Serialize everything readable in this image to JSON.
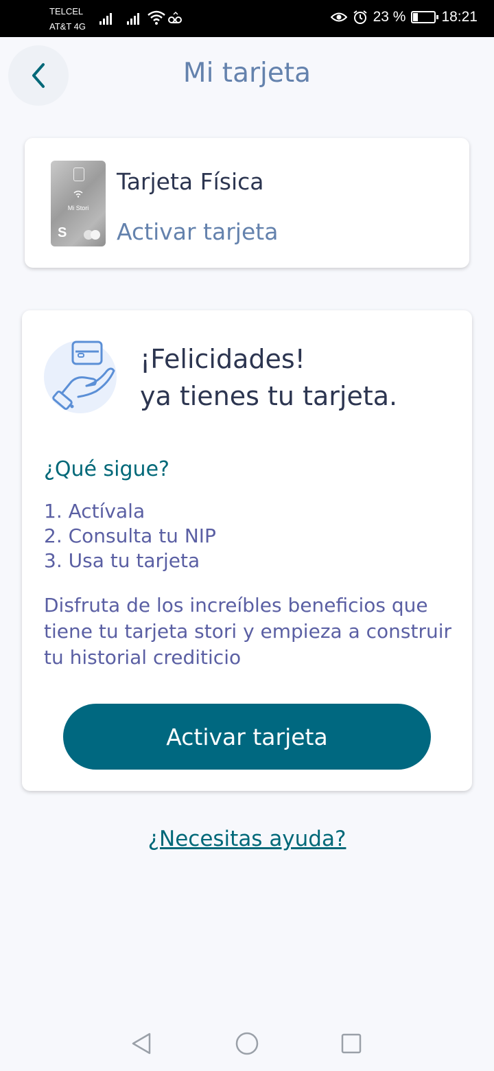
{
  "status_bar": {
    "carrier_1": "TELCEL",
    "carrier_2": "AT&T 4G",
    "battery_percent": "23 %",
    "battery_level": 0.23,
    "time": "18:21",
    "icons": [
      "signal-icon",
      "signal-icon",
      "wifi-icon",
      "voicemail-icon",
      "eye-icon",
      "alarm-icon",
      "battery-icon"
    ]
  },
  "header": {
    "title": "Mi tarjeta",
    "back_icon": "chevron-left-icon"
  },
  "card_summary": {
    "card_name": "Tarjeta Física",
    "card_brand_text": "Mi Stori",
    "action_label": "Activar tarjeta"
  },
  "main_card": {
    "headline_line1": "¡Felicidades!",
    "headline_line2": "ya tienes tu tarjeta.",
    "next_title": "¿Qué sigue?",
    "steps": [
      "1. Actívala",
      "2. Consulta tu NIP",
      "3. Usa tu tarjeta"
    ],
    "description": "Disfruta de los increíbles beneficios que tiene tu tarjeta stori y empieza a construir tu historial crediticio",
    "button_label": "Activar tarjeta"
  },
  "help_link": "¿Necesitas ayuda?",
  "colors": {
    "accent": "#006880",
    "title_blue": "#6482ad",
    "text_dark": "#2c3550",
    "text_purple": "#5a5fa3"
  },
  "nav": {
    "icons": [
      "back-triangle-icon",
      "home-circle-icon",
      "recents-square-icon"
    ]
  }
}
